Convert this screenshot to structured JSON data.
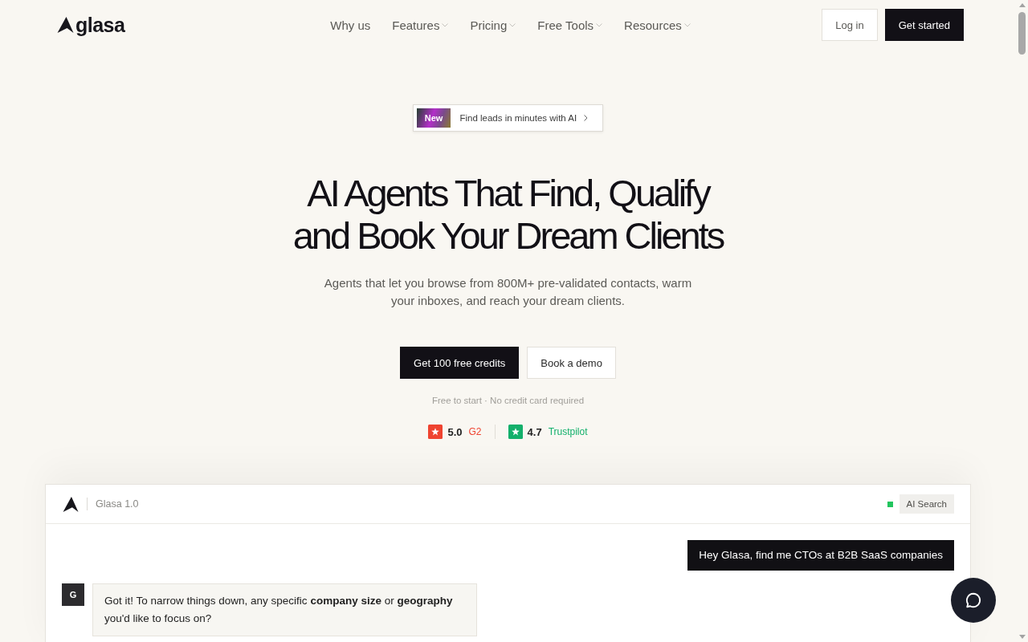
{
  "nav": {
    "logo": "glasa",
    "links": [
      {
        "label": "Why us",
        "dropdown": false
      },
      {
        "label": "Features",
        "dropdown": true
      },
      {
        "label": "Pricing",
        "dropdown": true
      },
      {
        "label": "Free Tools",
        "dropdown": true
      },
      {
        "label": "Resources",
        "dropdown": true
      }
    ],
    "buttons": [
      {
        "label": "Log in",
        "kind": "secondary"
      },
      {
        "label": "Get started",
        "kind": "primary"
      }
    ]
  },
  "hero": {
    "badge": {
      "tag": "New",
      "text": "Find leads in minutes with AI"
    },
    "title": "AI Agents That Find, Qualify\nand Book Your Dream Clients",
    "subtitle": "Agents that let you browse from 800M+ pre-validated contacts, warm\nyour inboxes, and reach your dream clients.",
    "buttons": [
      {
        "label": "Get 100 free credits",
        "kind": "primary"
      },
      {
        "label": "Book a demo",
        "kind": "secondary"
      }
    ],
    "note": "Free to start · No credit card required",
    "ratings": [
      {
        "score": "5.0",
        "source": "G2",
        "color": "#ef4330"
      },
      {
        "score": "4.7",
        "source": "Trustpilot",
        "color": "#13b06b"
      }
    ]
  },
  "chat": {
    "title": "Glasa 1.0",
    "mode": "AI Search",
    "messages": [
      {
        "kind": "user",
        "text": "Hey Glasa, find me CTOs at B2B SaaS companies"
      },
      {
        "kind": "assistant",
        "avatar": "G",
        "text": "Got it! To narrow things down, any specific **company size** or **geography** you'd like to focus on?"
      }
    ]
  }
}
